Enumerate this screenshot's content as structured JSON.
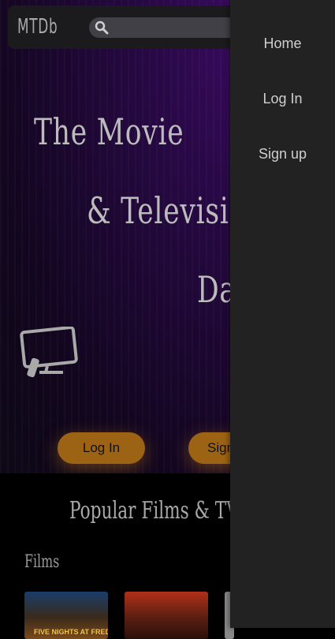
{
  "app": {
    "logo": "MTDb",
    "search_placeholder": ""
  },
  "hero": {
    "line1": "The Movie",
    "line2": "& Television",
    "line3": "Data",
    "login_label": "Log In",
    "signup_label": "Sign up"
  },
  "section": {
    "popular_title": "Popular Films & TV Sh",
    "films_label": "Films",
    "posters": [
      {
        "text": "FIVE NIGHTS AT FREDDY'S"
      },
      {
        "text": ""
      }
    ]
  },
  "drawer": {
    "items": [
      {
        "label": "Home"
      },
      {
        "label": "Log In"
      },
      {
        "label": "Sign up"
      }
    ]
  },
  "colors": {
    "accent_button": "#9c6314",
    "drawer_bg": "#222222",
    "topbar_bg": "#1b1b1d"
  }
}
